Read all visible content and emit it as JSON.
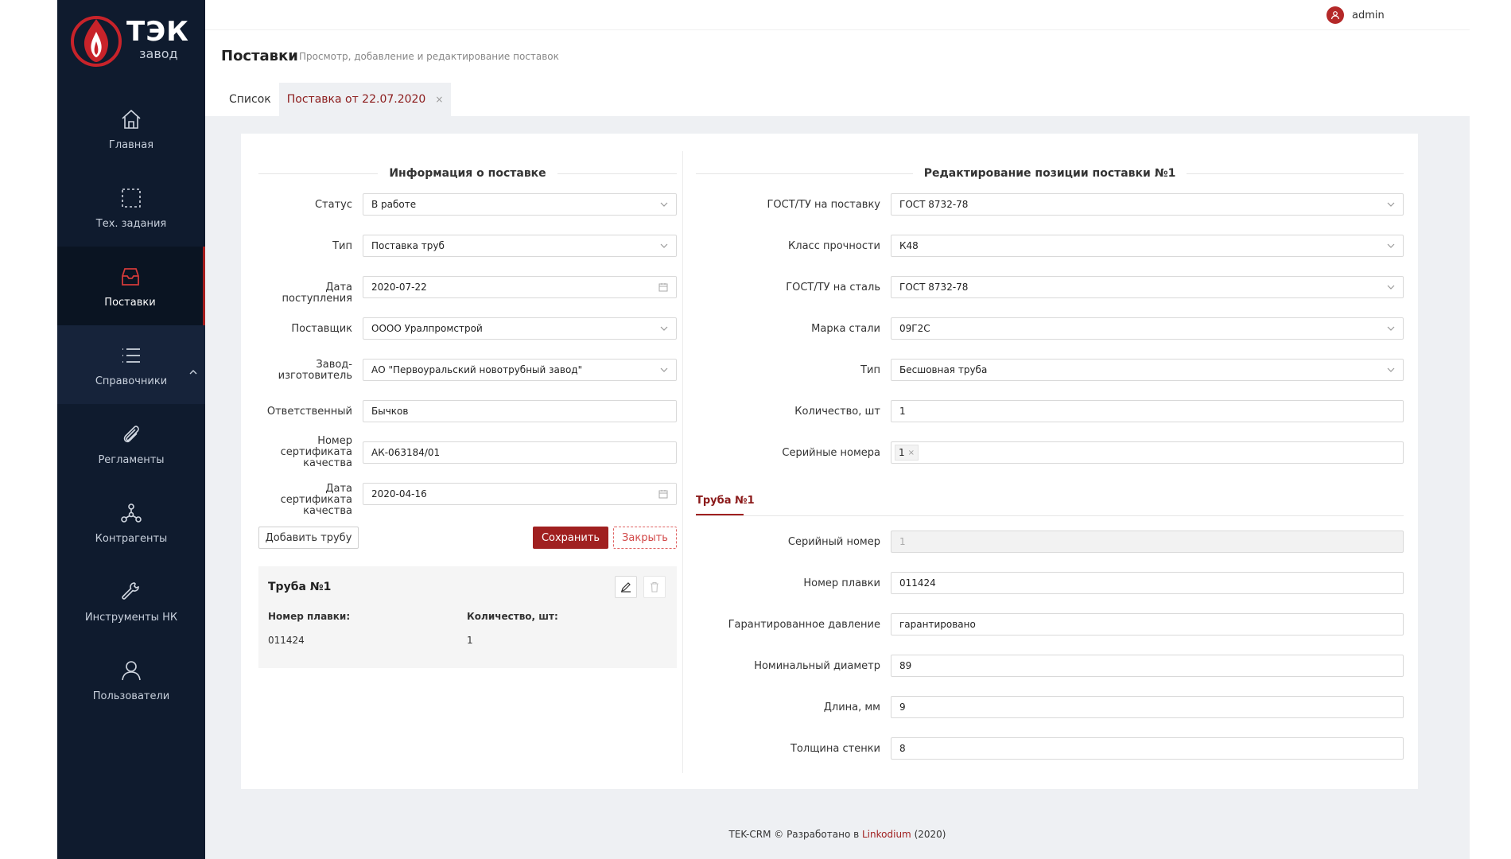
{
  "brand": {
    "name": "ТЭК",
    "sub": "завод"
  },
  "colors": {
    "accent": "#a02020",
    "sidebar": "#0f1b2e"
  },
  "sidebar": {
    "items": [
      {
        "label": "Главная",
        "icon": "home-icon"
      },
      {
        "label": "Тех. задания",
        "icon": "selection-icon"
      },
      {
        "label": "Поставки",
        "icon": "inbox-icon",
        "active": true
      },
      {
        "label": "Справочники",
        "icon": "list-icon"
      },
      {
        "label": "Регламенты",
        "icon": "paperclip-icon"
      },
      {
        "label": "Контрагенты",
        "icon": "nodes-icon"
      },
      {
        "label": "Инструменты НК",
        "icon": "wrench-icon"
      },
      {
        "label": "Пользователи",
        "icon": "user-icon"
      }
    ]
  },
  "header": {
    "user": "admin"
  },
  "page": {
    "title": "Поставки",
    "subtitle": "Просмотр, добавление и редактирование поставок",
    "tabs": [
      {
        "label": "Список"
      },
      {
        "label": "Поставка от 22.07.2020",
        "close": "×"
      }
    ]
  },
  "info": {
    "title": "Информация о поставке",
    "fields": {
      "status": {
        "label": "Статус",
        "value": "В работе"
      },
      "type": {
        "label": "Тип",
        "value": "Поставка труб"
      },
      "arrival": {
        "label": "Дата поступления",
        "value": "2020-07-22"
      },
      "supplier": {
        "label": "Поставщик",
        "value": "ОООО Уралпромстрой"
      },
      "maker_l1": "Завод-",
      "maker_l2": "изготовитель",
      "maker": {
        "value": "АО \"Первоуральский новотрубный завод\""
      },
      "responsible": {
        "label": "Ответственный",
        "value": "Бычков"
      },
      "cert_l1": "Номер",
      "cert_l2": "сертификата",
      "cert_l3": "качества",
      "cert": {
        "value": "АК-063184/01"
      },
      "certdate_l1": "Дата сертификата",
      "certdate_l2": "качества",
      "certdate": {
        "value": "2020-04-16"
      }
    },
    "buttons": {
      "add": "Добавить трубу",
      "save": "Сохранить",
      "close": "Закрыть"
    },
    "pipe": {
      "title": "Труба №1",
      "heat_label": "Номер плавки",
      "heat_value": "011424",
      "qty_label": "Количество, шт",
      "qty_value": "1",
      "colon": ":"
    }
  },
  "edit": {
    "title": "Редактирование позиции поставки №1",
    "fields": {
      "gost": {
        "label": "ГОСТ/ТУ на поставку",
        "value": "ГОСТ 8732-78"
      },
      "class": {
        "label": "Класс прочности",
        "value": "К48"
      },
      "gost_steel": {
        "label": "ГОСТ/ТУ на сталь",
        "value": "ГОСТ 8732-78"
      },
      "grade": {
        "label": "Марка стали",
        "value": "09Г2С"
      },
      "type": {
        "label": "Тип",
        "value": "Бесшовная труба"
      },
      "qty": {
        "label": "Количество, шт",
        "value": "1"
      },
      "serials": {
        "label": "Серийные номера",
        "tag": "1",
        "tag_x": "×"
      }
    },
    "subtab": "Труба №1",
    "pipe_fields": {
      "serial": {
        "label": "Серийный номер",
        "value": "1"
      },
      "heat": {
        "label": "Номер плавки",
        "value": "011424"
      },
      "pressure": {
        "label": "Гарантированное давление",
        "value": "гарантировано"
      },
      "diameter": {
        "label": "Номинальный диаметр",
        "value": "89"
      },
      "length": {
        "label": "Длина, мм",
        "value": "9"
      },
      "wall": {
        "label": "Толщина стенки",
        "value": "8"
      }
    }
  },
  "footer": {
    "prefix": "TEK-CRM © Разработано в",
    "link": "Linkodium",
    "suffix": "(2020)"
  }
}
